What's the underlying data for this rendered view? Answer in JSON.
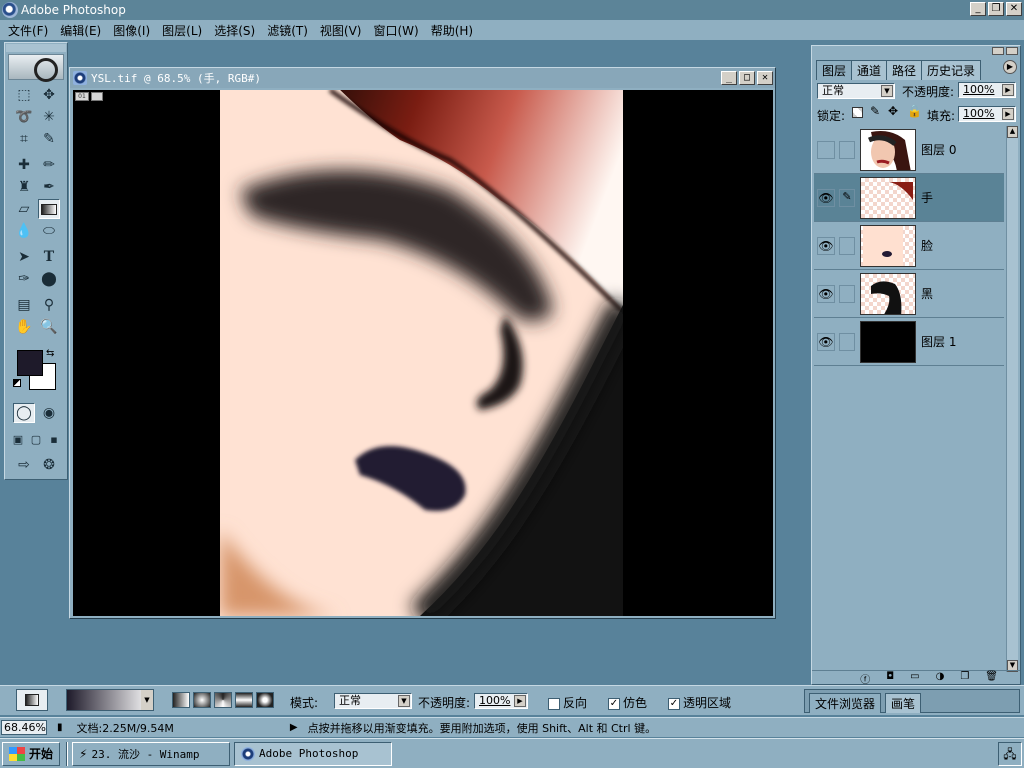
{
  "app": {
    "title": "Adobe Photoshop",
    "window_buttons": [
      "_",
      "❐",
      "✕"
    ]
  },
  "menu": [
    "文件(F)",
    "编辑(E)",
    "图像(I)",
    "图层(L)",
    "选择(S)",
    "滤镜(T)",
    "视图(V)",
    "窗口(W)",
    "帮助(H)"
  ],
  "document": {
    "title": "YSL.tif @ 68.5% (手, RGB#)",
    "buttons": [
      "_",
      "□",
      "✕"
    ]
  },
  "toolbox": {
    "tools": [
      "marquee-tool",
      "move-tool",
      "lasso-tool",
      "magic-wand-tool",
      "crop-tool",
      "slice-tool",
      "healing-brush-tool",
      "brush-tool",
      "clone-stamp-tool",
      "history-brush-tool",
      "eraser-tool",
      "gradient-tool",
      "blur-tool",
      "dodge-tool",
      "path-select-tool",
      "type-tool",
      "pen-tool",
      "shape-tool",
      "notes-tool",
      "eyedropper-tool",
      "hand-tool",
      "zoom-tool"
    ],
    "selected": "gradient-tool",
    "colors": {
      "foreground": "#1e1a2a",
      "background": "#ffffff"
    }
  },
  "layers_panel": {
    "tabs": [
      "图层",
      "通道",
      "路径",
      "历史记录"
    ],
    "active_tab": "图层",
    "blend_mode": "正常",
    "opacity_label": "不透明度:",
    "opacity_value": "100%",
    "lock_label": "锁定:",
    "fill_label": "填充:",
    "fill_value": "100%",
    "layers": [
      {
        "name": "图层 0",
        "visible": false,
        "active": false
      },
      {
        "name": "手",
        "visible": true,
        "active": true
      },
      {
        "name": "脸",
        "visible": true,
        "active": false
      },
      {
        "name": "黑",
        "visible": true,
        "active": false
      },
      {
        "name": "图层 1",
        "visible": true,
        "active": false
      }
    ]
  },
  "options_bar": {
    "mode_label": "模式:",
    "mode_value": "正常",
    "opacity_label": "不透明度:",
    "opacity_value": "100%",
    "reverse_label": "反向",
    "dither_label": "仿色",
    "transparency_label": "透明区域",
    "reverse_checked": false,
    "dither_checked": true,
    "transparency_checked": true
  },
  "palette_well": {
    "tabs": [
      "文件浏览器",
      "画笔"
    ]
  },
  "status": {
    "zoom": "68.46%",
    "doc_size": "文档:2.25M/9.54M",
    "message": "点按并拖移以用渐变填充。要用附加选项，使用 Shift、Alt 和 Ctrl 键。"
  },
  "taskbar": {
    "start_label": "开始",
    "items": [
      "23. 流沙 - Winamp",
      "Adobe Photoshop"
    ],
    "active_item": "Adobe Photoshop"
  }
}
